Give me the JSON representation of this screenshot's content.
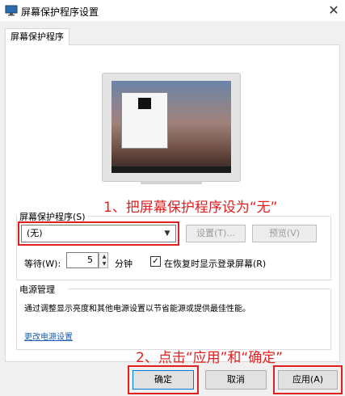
{
  "window": {
    "title": "屏幕保护程序设置",
    "close_glyph": "✕"
  },
  "tabs": [
    {
      "label": "屏幕保护程序"
    }
  ],
  "screensaver": {
    "group_label": "屏幕保护程序(S)",
    "selected": "(无)",
    "settings_label": "设置(T)...",
    "preview_label": "预览(V)",
    "wait_label": "等待(W):",
    "wait_value": "5",
    "wait_unit": "分钟",
    "resume_checked": true,
    "resume_label": "在恢复时显示登录屏幕(R)"
  },
  "power": {
    "group_label": "电源管理",
    "description": "通过调整显示亮度和其他电源设置以节省能源或提供最佳性能。",
    "link": "更改电源设置"
  },
  "annotations": {
    "step1": "1、把屏幕保护程序设为“无”",
    "step2": "2、点击“应用”和“确定”",
    "color": "#e02020"
  },
  "buttons": {
    "ok": "确定",
    "cancel": "取消",
    "apply": "应用(A)"
  },
  "icons": {
    "dropdown": "chevron-down-icon",
    "check": "checkmark-icon",
    "spin_up": "▲",
    "spin_down": "▼"
  }
}
